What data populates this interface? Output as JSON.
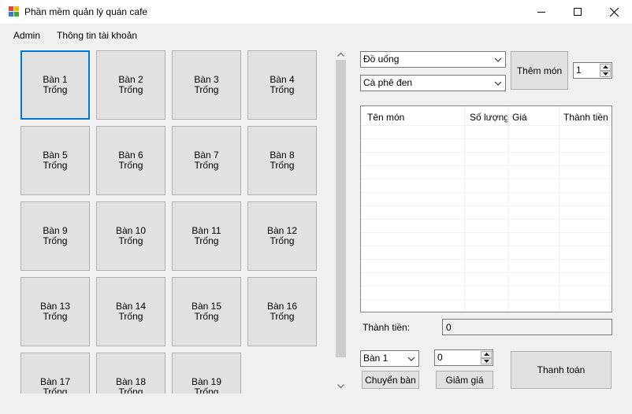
{
  "window": {
    "title": "Phần mềm quản lý quán cafe",
    "icon": "app-icon",
    "controls": [
      "minimize-icon",
      "maximize-icon",
      "close-icon"
    ]
  },
  "menu": {
    "items": [
      {
        "label": "Admin"
      },
      {
        "label": "Thông tin tài khoản"
      }
    ]
  },
  "tables": [
    {
      "name": "Bàn 1",
      "status": "Trống",
      "selected": true
    },
    {
      "name": "Bàn 2",
      "status": "Trống"
    },
    {
      "name": "Bàn 3",
      "status": "Trống"
    },
    {
      "name": "Bàn 4",
      "status": "Trống"
    },
    {
      "name": "Bàn 5",
      "status": "Trống"
    },
    {
      "name": "Bàn 6",
      "status": "Trống"
    },
    {
      "name": "Bàn 7",
      "status": "Trống"
    },
    {
      "name": "Bàn 8",
      "status": "Trống"
    },
    {
      "name": "Bàn 9",
      "status": "Trống"
    },
    {
      "name": "Bàn 10",
      "status": "Trống"
    },
    {
      "name": "Bàn 11",
      "status": "Trống"
    },
    {
      "name": "Bàn 12",
      "status": "Trống"
    },
    {
      "name": "Bàn 13",
      "status": "Trống"
    },
    {
      "name": "Bàn 14",
      "status": "Trống"
    },
    {
      "name": "Bàn 15",
      "status": "Trống"
    },
    {
      "name": "Bàn 16",
      "status": "Trống"
    },
    {
      "name": "Bàn 17",
      "status": "Trống"
    },
    {
      "name": "Bàn 18",
      "status": "Trống"
    },
    {
      "name": "Bàn 19",
      "status": "Trống"
    }
  ],
  "order": {
    "category": "Đồ uống",
    "food": "Cà phê đen",
    "add_button": "Thêm món",
    "quantity": "1"
  },
  "bill": {
    "columns": [
      "Tên món",
      "Số lượng",
      "Giá",
      "Thành tiền"
    ],
    "rows": []
  },
  "total": {
    "label": "Thành tiền:",
    "value": "0"
  },
  "footer": {
    "switch_table_value": "Bàn 1",
    "switch_table_button": "Chuyển bàn",
    "discount_value": "0",
    "discount_button": "Giảm giá",
    "checkout_button": "Thanh toán"
  },
  "colors": {
    "selected_border": "#0078d7",
    "button_face": "#e1e1e1",
    "window_bg": "#f0f0f0"
  }
}
